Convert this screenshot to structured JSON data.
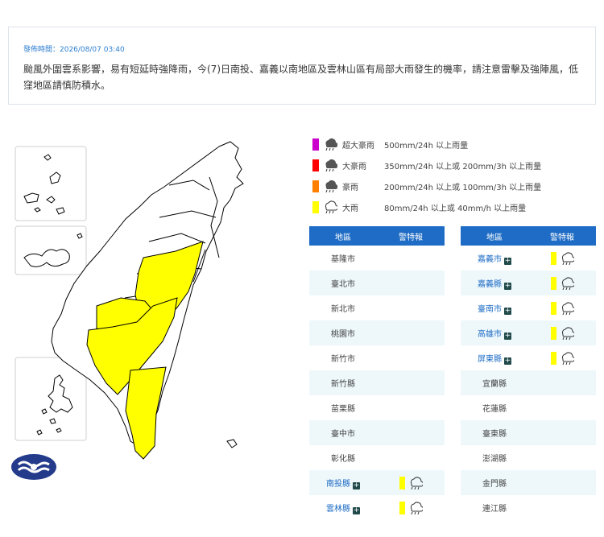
{
  "notice": {
    "time": "發佈時間：2026/08/07 03:40",
    "message": "颱風外圍雲系影響，易有短延時強降雨，今(7)日南投、嘉義以南地區及雲林山區有局部大雨發生的機率，請注意雷擊及強陣風，低窪地區請慎防積水。"
  },
  "legend": [
    {
      "name": "超大豪雨",
      "desc": "500mm/24h 以上雨量",
      "color": "#cc00cc"
    },
    {
      "name": "大豪雨",
      "desc": "350mm/24h 以上或 200mm/3h 以上雨量",
      "color": "#ff0000"
    },
    {
      "name": "豪雨",
      "desc": "200mm/24h 以上或 100mm/3h 以上雨量",
      "color": "#ff8000"
    },
    {
      "name": "大雨",
      "desc": "80mm/24h 以上或 40mm/h 以上雨量",
      "color": "#ffff00"
    }
  ],
  "table": {
    "header_area": "地區",
    "header_warning": "警特報",
    "left": [
      {
        "area": "基隆市",
        "warn": false
      },
      {
        "area": "臺北市",
        "warn": false
      },
      {
        "area": "新北市",
        "warn": false
      },
      {
        "area": "桃園市",
        "warn": false
      },
      {
        "area": "新竹市",
        "warn": false
      },
      {
        "area": "新竹縣",
        "warn": false
      },
      {
        "area": "苗栗縣",
        "warn": false
      },
      {
        "area": "臺中市",
        "warn": false
      },
      {
        "area": "彰化縣",
        "warn": false
      },
      {
        "area": "南投縣",
        "warn": true
      },
      {
        "area": "雲林縣",
        "warn": true
      }
    ],
    "right": [
      {
        "area": "嘉義市",
        "warn": true
      },
      {
        "area": "嘉義縣",
        "warn": true
      },
      {
        "area": "臺南市",
        "warn": true
      },
      {
        "area": "高雄市",
        "warn": true
      },
      {
        "area": "屏東縣",
        "warn": true
      },
      {
        "area": "宜蘭縣",
        "warn": false
      },
      {
        "area": "花蓮縣",
        "warn": false
      },
      {
        "area": "臺東縣",
        "warn": false
      },
      {
        "area": "澎湖縣",
        "warn": false
      },
      {
        "area": "金門縣",
        "warn": false
      },
      {
        "area": "連江縣",
        "warn": false
      }
    ]
  },
  "icons": {
    "plus": "+",
    "rain": "rain-cloud-icon",
    "logo": "cwa-logo"
  },
  "colors": {
    "header": "#1e6cc5",
    "alert": "#ffff00",
    "row_alt": "#eef8fb"
  }
}
